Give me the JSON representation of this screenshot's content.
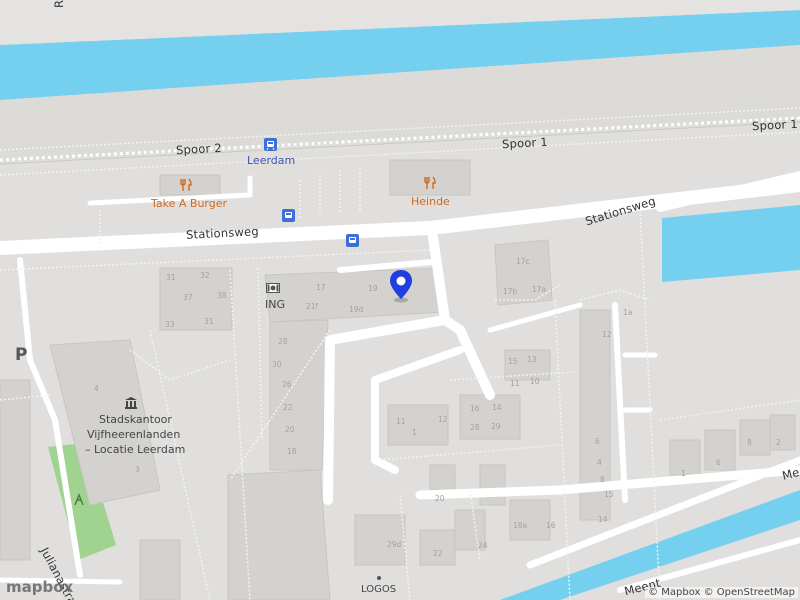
{
  "map": {
    "roads": {
      "top_partial": "Roel",
      "spoor2": "Spoor 2",
      "spoor1_a": "Spoor 1",
      "spoor1_b": "Spoor 1",
      "stationsweg_a": "Stationsweg",
      "stationsweg_b": "Stationsweg",
      "julianastraat": "Julianastra",
      "meent_a": "Meent",
      "meent_b": "Mee"
    },
    "stations": {
      "leerdam": "Leerdam"
    },
    "pois": {
      "take_a_burger": "Take A Burger",
      "heinde": "Heinde",
      "ing": "ING",
      "stadskantoor_1": "Stadskantoor",
      "stadskantoor_2": "Vijfheerenlanden",
      "stadskantoor_3": "– Locatie Leerdam",
      "logos": "LOGOS",
      "parking": "P"
    },
    "house_numbers": [
      "31",
      "32",
      "37",
      "38",
      "31",
      "33",
      "17",
      "19",
      "21f",
      "19d",
      "28",
      "30",
      "26",
      "22",
      "20",
      "18",
      "17c",
      "17b",
      "17a",
      "15",
      "13",
      "11",
      "1",
      "12",
      "16",
      "14",
      "11",
      "10",
      "28",
      "29",
      "3",
      "4",
      "6",
      "8",
      "1",
      "2",
      "24",
      "22",
      "18a",
      "16",
      "29d",
      "20",
      "14",
      "15",
      "1a",
      "6",
      "4",
      "8",
      "12"
    ],
    "attribution": "© Mapbox © OpenStreetMap",
    "logo": "mapbox",
    "colors": {
      "water": "#75cfef",
      "road": "#ffffff",
      "land": "#e0dfdd",
      "building": "#d4d2cf",
      "park": "#9fd38f",
      "transit": "#3d6fd6",
      "food": "#d06a1e",
      "marker": "#1f3fe0"
    }
  }
}
